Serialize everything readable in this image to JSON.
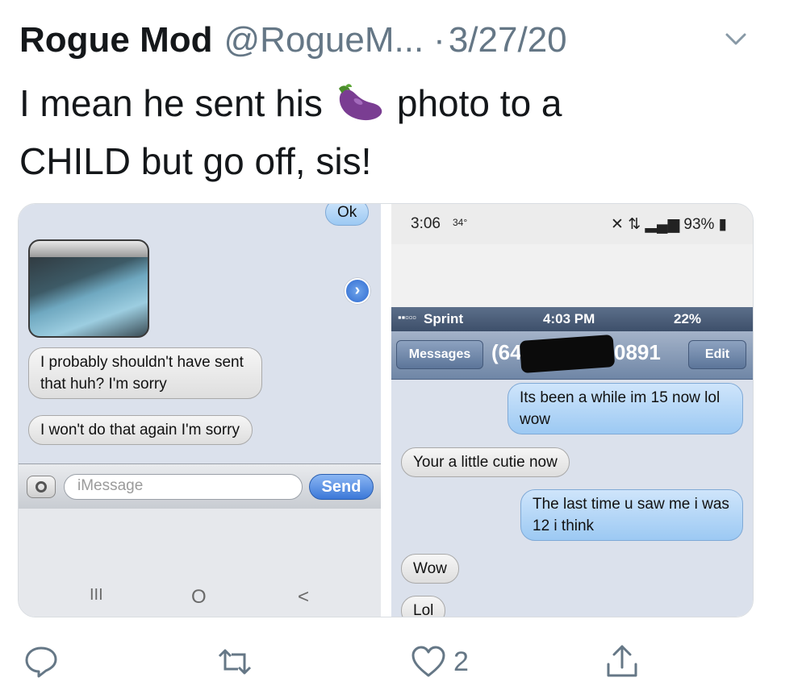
{
  "tweet": {
    "author_name": "Rogue Mod",
    "author_handle": "@RogueM...",
    "separator": "·",
    "date": "3/27/20",
    "text_line1_before": "I mean he sent his",
    "text_line1_after": "photo to a",
    "text_line2": "CHILD but go off, sis!",
    "emoji_icon": "eggplant-icon"
  },
  "left_screenshot": {
    "ok_bubble": "Ok",
    "messages": [
      "I probably shouldn't have sent that huh? I'm sorry",
      "I won't do that again I'm sorry"
    ],
    "input_placeholder": "iMessage",
    "send_label": "Send",
    "nav_recent": "III",
    "nav_home": "O",
    "nav_back": "<"
  },
  "right_screenshot": {
    "android_status_time": "3:06",
    "android_status_extra": "34°",
    "android_status_battery": "93%",
    "ios_carrier": "Sprint",
    "ios_time": "4:03 PM",
    "ios_battery": "22%",
    "back_label": "Messages",
    "contact_prefix": "(64",
    "contact_suffix": "0891",
    "edit_label": "Edit",
    "messages": [
      {
        "side": "sent",
        "text": "Its been a while im 15 now lol wow"
      },
      {
        "side": "received",
        "text": "Your a little cutie now"
      },
      {
        "side": "sent",
        "text": "The last time u saw me i was 12 i think"
      },
      {
        "side": "received",
        "text": "Wow"
      },
      {
        "side": "received",
        "text": "Lol"
      }
    ]
  },
  "actions": {
    "reply_icon": "reply-icon",
    "retweet_icon": "retweet-icon",
    "like_icon": "heart-icon",
    "like_count": "2",
    "share_icon": "share-icon"
  },
  "colors": {
    "text_primary": "#14171a",
    "text_secondary": "#657786",
    "imessage_blue": "#9cc9f3",
    "chat_background": "#dbe1ec"
  }
}
